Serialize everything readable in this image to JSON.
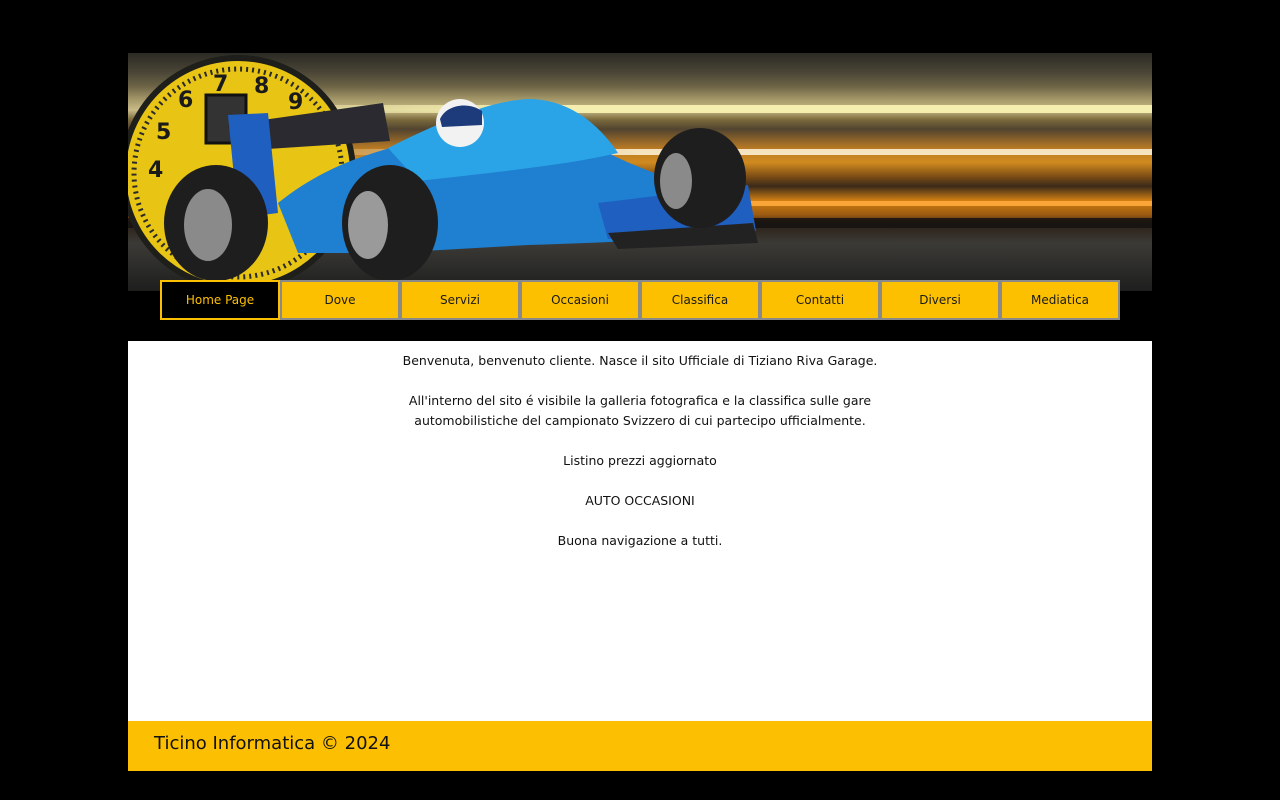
{
  "header": {
    "image_name": "race-car-banner",
    "gauge_numbers": [
      "4",
      "5",
      "6",
      "7",
      "8",
      "9"
    ]
  },
  "nav": {
    "active_index": 0,
    "items": [
      {
        "label": "Home Page"
      },
      {
        "label": "Dove"
      },
      {
        "label": "Servizi"
      },
      {
        "label": "Occasioni"
      },
      {
        "label": "Classifica"
      },
      {
        "label": "Contatti"
      },
      {
        "label": "Diversi"
      },
      {
        "label": "Mediatica"
      }
    ]
  },
  "main": {
    "welcome": "Benvenuta, benvenuto cliente. Nasce il sito Ufficiale di Tiziano Riva Garage.",
    "gallery_line1": "All'interno del sito é visibile la galleria fotografica e la classifica sulle gare",
    "gallery_line2": "automobilistiche del campionato Svizzero di cui partecipo ufficialmente.",
    "price_list": "Listino prezzi aggiornato",
    "used_cars": "AUTO OCCASIONI",
    "closing": "Buona navigazione a tutti."
  },
  "footer": {
    "copyright": "Ticino Informatica © 2024"
  },
  "colors": {
    "background": "#000000",
    "accent": "#fdc001",
    "content_bg": "#ffffff",
    "footer_bg": "#fdbf01"
  }
}
